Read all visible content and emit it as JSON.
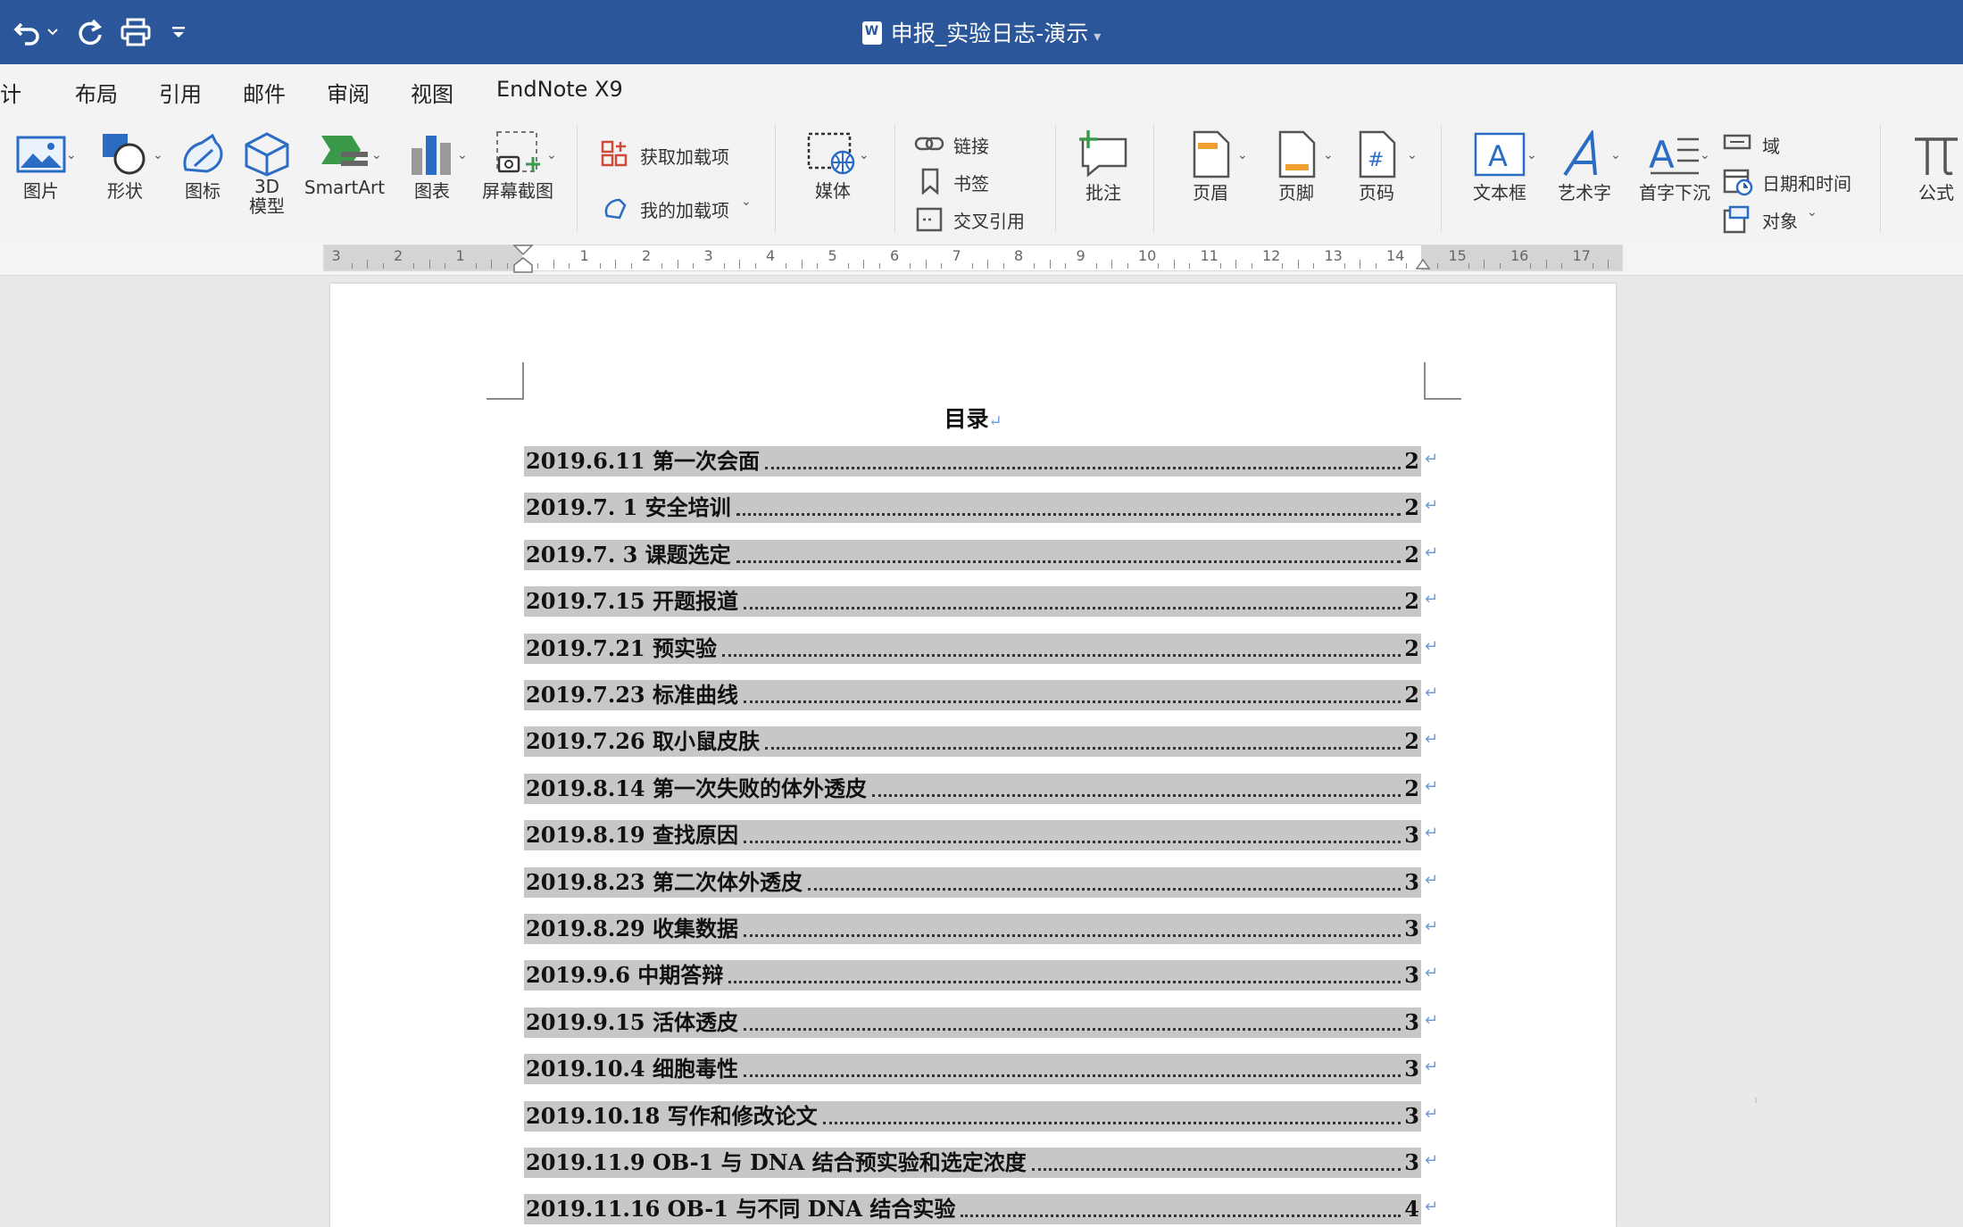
{
  "window": {
    "title": "申报_实验日志-演示"
  },
  "tabs": [
    "设计",
    "布局",
    "引用",
    "邮件",
    "审阅",
    "视图",
    "EndNote X9"
  ],
  "ribbon": {
    "picture": "图片",
    "shapes": "形状",
    "icons": "图标",
    "model3d_line1": "3D",
    "model3d_line2": "模型",
    "smartart": "SmartArt",
    "chart": "图表",
    "screenshot": "屏幕截图",
    "get_addins": "获取加载项",
    "my_addins": "我的加载项",
    "media": "媒体",
    "link": "链接",
    "bookmark": "书签",
    "cross_ref": "交叉引用",
    "comment": "批注",
    "header": "页眉",
    "footer": "页脚",
    "page_number": "页码",
    "textbox": "文本框",
    "wordart": "艺术字",
    "dropcap": "首字下沉",
    "field": "域",
    "datetime": "日期和时间",
    "object": "对象",
    "equation": "公式"
  },
  "ruler": {
    "left_labels": [
      "3",
      "2",
      "1"
    ],
    "right_labels": [
      "1",
      "2",
      "3",
      "4",
      "5",
      "6",
      "7",
      "8",
      "9",
      "10",
      "11",
      "12",
      "13",
      "14",
      "15",
      "16",
      "17"
    ]
  },
  "document": {
    "toc_title": "目录",
    "entries": [
      {
        "text": "2019.6.11  第一次会面",
        "page": "2"
      },
      {
        "text": "2019.7. 1 安全培训",
        "page": "2"
      },
      {
        "text": "2019.7. 3 课题选定",
        "page": "2"
      },
      {
        "text": "2019.7.15 开题报道",
        "page": "2"
      },
      {
        "text": "2019.7.21 预实验",
        "page": "2"
      },
      {
        "text": "2019.7.23 标准曲线",
        "page": "2"
      },
      {
        "text": "2019.7.26 取小鼠皮肤",
        "page": "2"
      },
      {
        "text": "2019.8.14 第一次失败的体外透皮",
        "page": "2"
      },
      {
        "text": "2019.8.19 查找原因",
        "page": "3"
      },
      {
        "text": "2019.8.23 第二次体外透皮",
        "page": "3"
      },
      {
        "text": "2019.8.29 收集数据",
        "page": "3"
      },
      {
        "text": "2019.9.6 中期答辩",
        "page": "3"
      },
      {
        "text": "2019.9.15 活体透皮",
        "page": "3"
      },
      {
        "text": "2019.10.4 细胞毒性",
        "page": "3"
      },
      {
        "text": "2019.10.18 写作和修改论文",
        "page": "3"
      },
      {
        "text": "2019.11.9 OB-1 与 DNA 结合预实验和选定浓度",
        "page": "3"
      },
      {
        "text": "2019.11.16 OB-1 与不同 DNA 结合实验",
        "page": "4"
      }
    ]
  },
  "colors": {
    "titlebar": "#2b579a",
    "ribbon_accent": "#2b6cc4",
    "toc_highlight": "#c7c7c7"
  }
}
